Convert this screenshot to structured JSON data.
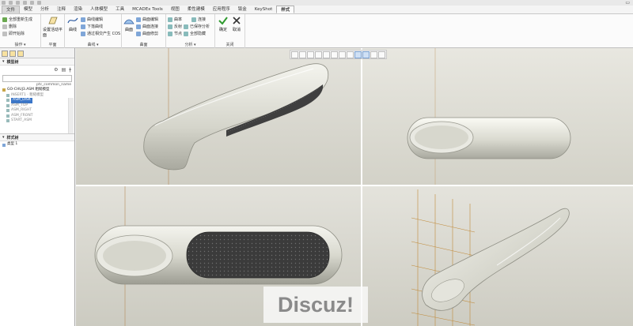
{
  "menu": {
    "tabs": [
      "文件",
      "模型",
      "分析",
      "注释",
      "渲染",
      "人体模型",
      "工具",
      "MCADEx Tools",
      "视图",
      "柔性建模",
      "应用程序",
      "钣金",
      "KeyShot",
      "样式"
    ],
    "active_tab": "样式"
  },
  "ribbon": {
    "group_operations": {
      "label": "操作",
      "items": [
        "全部重新生成",
        "删除",
        "即开始除"
      ]
    },
    "group_plane": {
      "label": "平面",
      "item": "设置活动平面"
    },
    "group_curves": {
      "label": "曲线",
      "big": "曲线",
      "items": [
        "曲线编辑",
        "下落曲线",
        "通过相交产生 COS"
      ]
    },
    "group_surface": {
      "label": "曲面",
      "big": "曲面",
      "items": [
        "曲面编辑",
        "曲面连接",
        "曲面修剪"
      ]
    },
    "group_analysis": {
      "label": "分析",
      "items": [
        "曲率",
        "连接",
        "反射",
        "已保存分析",
        "节点",
        "全部隐藏"
      ]
    },
    "group_close": {
      "label": "关闭",
      "confirm": "确定",
      "cancel": "取消"
    }
  },
  "left_panel": {
    "model_tree_title": "模型树",
    "tree_column_header": "ptc_common_name",
    "tree_items": [
      {
        "label": "GO-CHUJ3.ASM 粗糙模型",
        "state": "root"
      },
      {
        "label": "INSERT1 · 粗糙模型",
        "state": "normal"
      },
      {
        "label": "ASM_DISK",
        "state": "selected"
      },
      {
        "label": "ASM_TOP",
        "state": "normal"
      },
      {
        "label": "ASM_RIGHT",
        "state": "normal"
      },
      {
        "label": "ASM_FRONT",
        "state": "normal"
      },
      {
        "label": "START_ASM",
        "state": "normal"
      }
    ],
    "style_tree_title": "样式树",
    "style_tree_item": "类型 1"
  },
  "viewport": {
    "watermark": "Discuz!",
    "toolbar_icons": [
      "zoom-window-icon",
      "zoom-in-icon",
      "zoom-out-icon",
      "refit-icon",
      "repaint-icon",
      "display-style-icon",
      "saved-views-icon",
      "spin-center-icon",
      "datum-display-icon",
      "layout-icon",
      "annotation-icon",
      "display-icon"
    ],
    "colors": {
      "background": "#d9d8cf",
      "model": "#dcdcd2",
      "grip": "#3a3a3a",
      "selected_tab": "#3b76c8"
    }
  }
}
